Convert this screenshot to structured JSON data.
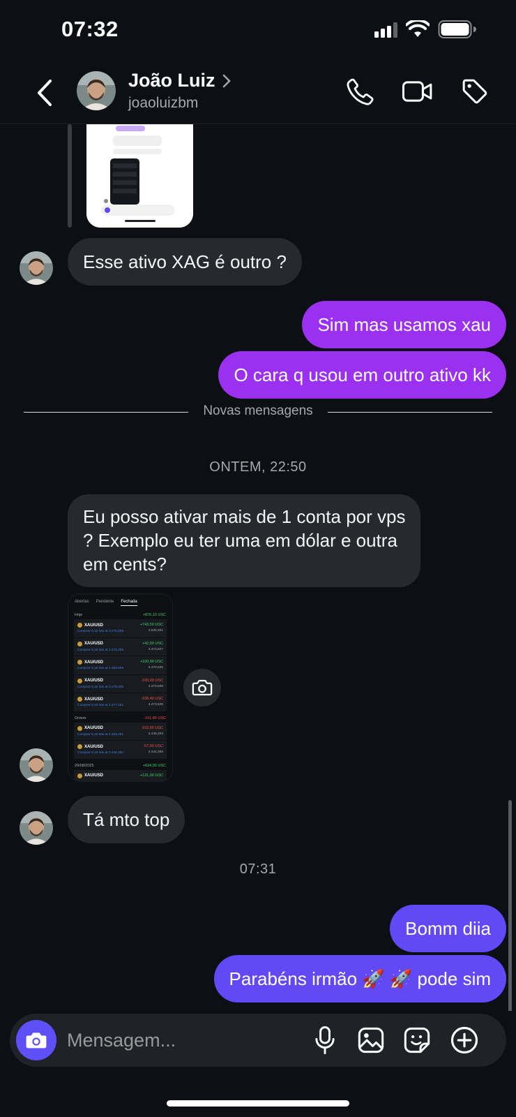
{
  "status_bar": {
    "time": "07:32"
  },
  "header": {
    "name": "João Luiz",
    "handle": "joaoluizbm",
    "icons": [
      "back-chevron-icon",
      "phone-icon",
      "video-camera-icon",
      "tag-icon"
    ]
  },
  "messages": {
    "m1": "Esse ativo XAG é outro ?",
    "m2": "Sim mas usamos xau",
    "m3": "O cara q usou em outro ativo kk",
    "m4_lines": [
      "Eu posso ativar mais de 1 conta por vps",
      "? Exemplo eu ter uma em dólar e outra",
      "em cents?"
    ],
    "m5": "Tá mto top",
    "m6": "Bomm diia",
    "m7": "Parabéns irmão 🚀 🚀 pode sim"
  },
  "divider": {
    "label": "Novas mensagens"
  },
  "timestamps": {
    "t1": "ONTEM, 22:50",
    "t2": "07:31"
  },
  "shared_screenshot": {
    "tabs": [
      "Abertas",
      "Pendente",
      "Fechada"
    ],
    "sections": [
      {
        "label": "Hoje",
        "total": "+876,10 USC",
        "rows": [
          {
            "symbol": "XAU/USD",
            "detail": "Comprar 0,15 lots at 3.475,569",
            "pl": "+743,50 USC",
            "price": "3.525,201",
            "up": true
          },
          {
            "symbol": "XAU/USD",
            "detail": "Comprar 0,15 lots at 3.476,255",
            "pl": "+42,50 USC",
            "price": "3.473,847",
            "up": true
          },
          {
            "symbol": "XAU/USD",
            "detail": "Comprar 0,15 lots at 3.469,599",
            "pl": "+100,90 USC",
            "price": "3.470,635",
            "up": true
          },
          {
            "symbol": "XAU/USD",
            "detail": "Comprar 0,15 lots at 3.478,046",
            "pl": "-100,00 USC",
            "price": "3.473,849",
            "up": false
          },
          {
            "symbol": "XAU/USD",
            "detail": "Comprar 0,15 lots at 3.477,281",
            "pl": "-108,40 USC",
            "price": "3.473,525",
            "up": false
          }
        ]
      },
      {
        "label": "Ontem",
        "total": "-161,80 USC",
        "rows": [
          {
            "symbol": "XAU/USD",
            "detail": "Comprar 0,15 lots at 3.453,361",
            "pl": "-103,90 USC",
            "price": "3.446,203",
            "up": false
          },
          {
            "symbol": "XAU/USD",
            "detail": "Comprar 0,15 lots at 3.446,352",
            "pl": "-57,90 USC",
            "price": "3.444,356",
            "up": false
          }
        ]
      },
      {
        "label": "29/08/2025",
        "total": "+634,00 USC",
        "rows": [
          {
            "symbol": "XAU/USD",
            "detail": "",
            "pl": "+131,90 USC",
            "price": "",
            "up": true
          }
        ]
      }
    ]
  },
  "composer": {
    "placeholder": "Mensagem..."
  },
  "colors": {
    "background": "#0c1014",
    "incoming": "#262a2f",
    "outgoing_purple": "#9b30f0",
    "outgoing_blue": "#6249f5",
    "accent": "#5d50f6"
  }
}
